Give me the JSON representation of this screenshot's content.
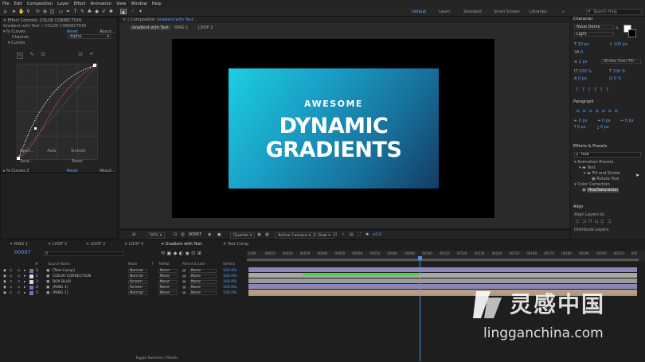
{
  "menu": [
    "File",
    "Edit",
    "Composition",
    "Layer",
    "Effect",
    "Animation",
    "View",
    "Window",
    "Help"
  ],
  "workspaces": [
    "Default",
    "Learn",
    "Standard",
    "Small Screen",
    "Libraries"
  ],
  "search_placeholder": "Search Help",
  "effect_controls": {
    "tab": "Effect Controls: COLOR CORRECTION",
    "subtitle": "Gradient with Text • COLOR CORRECTION",
    "curves_label": "Curves",
    "reset": "Reset",
    "about": "About...",
    "channel_label": "Channel:",
    "channel_value": "Alpha",
    "curves_sub": "Curves",
    "buttons_row1": [
      "Open...",
      "Auto",
      "Smooth"
    ],
    "buttons_row2": [
      "Save...",
      "",
      "Reset"
    ],
    "curves2_label": "Curves 2",
    "reset2": "Reset",
    "about2": "About..."
  },
  "composition": {
    "tab": "Composition",
    "tab_name": "Gradient with Text",
    "subtabs": [
      "Gradient with Text",
      "RING 1",
      "LOOP 2"
    ],
    "card_line1": "AWESOME",
    "card_line2": "DYNAMIC",
    "card_line3": "GRADIENTS",
    "zoom": "50%",
    "timecode": "00097",
    "quality": "Quarter",
    "camera": "Active Camera",
    "view": "1 View",
    "offset": "+0.0"
  },
  "character": {
    "tab": "Character",
    "font": "Neue Demo",
    "style": "Light",
    "size": "20 px",
    "leading": "100 px",
    "tracking": "0",
    "stroke": "2 px",
    "stroke_type": "Stroke Over Fill",
    "vscale": "100 %",
    "hscale": "100 %",
    "baseline": "0 px",
    "tsume": "0 %"
  },
  "paragraph": {
    "tab": "Paragraph",
    "indent1": "0 px",
    "indent2": "0 px",
    "indent3": "0 px",
    "space1": "0 px",
    "space2": "0 px"
  },
  "effects_presets": {
    "tab": "Effects & Presets",
    "search_value": "hue",
    "tree": [
      "Animation Presets",
      "Text",
      "Fill and Stroke",
      "Rotate Hue",
      "Color Correction",
      "Hue/Saturation"
    ]
  },
  "align": {
    "tab": "Align",
    "align_to": "Align Layers to:",
    "distribute": "Distribute Layers:"
  },
  "timeline": {
    "tabs": [
      "RING 1",
      "LOOP 2",
      "LOOP 3",
      "LOOP 4",
      "Gradient with Text",
      "Text Comp"
    ],
    "timecode": "00097",
    "headers": [
      "#",
      "Source Name",
      "Mode",
      "T",
      "TrkMat",
      "Parent & Link",
      "Stretch"
    ],
    "layers": [
      {
        "num": "1",
        "name": "[Text Comp]",
        "mode": "Normal",
        "trk": "None",
        "parent": "None",
        "stretch": "100.0%",
        "color": "#7a6fb8"
      },
      {
        "num": "2",
        "name": "COLOR CORRECTION",
        "mode": "Normal",
        "trk": "None",
        "parent": "None",
        "stretch": "100.0%",
        "color": "#d8d8d8"
      },
      {
        "num": "3",
        "name": "BOX BLUR",
        "mode": "Screen",
        "trk": "None",
        "parent": "None",
        "stretch": "100.0%",
        "color": "#d8d8d8"
      },
      {
        "num": "4",
        "name": "[RING 1]",
        "mode": "Screen",
        "trk": "None",
        "parent": "None",
        "stretch": "100.0%",
        "color": "#7a6fb8"
      },
      {
        "num": "5",
        "name": "[RING 1]",
        "mode": "Normal",
        "trk": "None",
        "parent": "None",
        "stretch": "100.0%",
        "color": "#7a6fb8"
      }
    ],
    "ruler": [
      "0:00f",
      "00010",
      "00020",
      "00030",
      "00040",
      "00050",
      "00060",
      "00070",
      "00080",
      "00090",
      "00100",
      "00110",
      "00120",
      "00130",
      "00140",
      "00150",
      "00160",
      "00170",
      "00180",
      "00190",
      "00200",
      "00210",
      "002"
    ],
    "toggle": "Toggle Switches / Modes"
  },
  "watermark": {
    "cn": "灵感中国",
    "url": "lingganchina.com"
  }
}
